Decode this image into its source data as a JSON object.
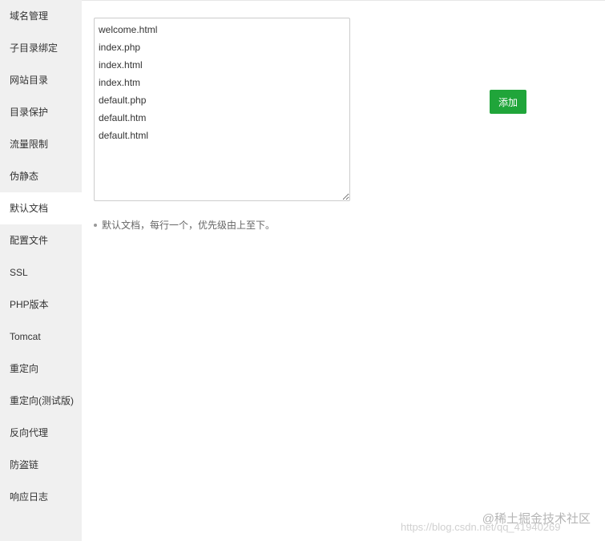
{
  "sidebar": {
    "items": [
      {
        "label": "域名管理"
      },
      {
        "label": "子目录绑定"
      },
      {
        "label": "网站目录"
      },
      {
        "label": "目录保护"
      },
      {
        "label": "流量限制"
      },
      {
        "label": "伪静态"
      },
      {
        "label": "默认文档",
        "active": true
      },
      {
        "label": "配置文件"
      },
      {
        "label": "SSL"
      },
      {
        "label": "PHP版本"
      },
      {
        "label": "Tomcat"
      },
      {
        "label": "重定向"
      },
      {
        "label": "重定向(测试版)"
      },
      {
        "label": "反向代理"
      },
      {
        "label": "防盗链"
      },
      {
        "label": "响应日志"
      }
    ]
  },
  "main": {
    "default_docs": "welcome.html\nindex.php\nindex.html\nindex.htm\ndefault.php\ndefault.htm\ndefault.html",
    "add_button_label": "添加",
    "help_text": "默认文档，每行一个，优先级由上至下。"
  },
  "watermark": {
    "main": "@稀土掘金技术社区",
    "url": "https://blog.csdn.net/qq_41940269"
  },
  "colors": {
    "accent": "#20a53a",
    "sidebar_bg": "#f0f0f0",
    "active_item_bg": "#ffffff"
  }
}
